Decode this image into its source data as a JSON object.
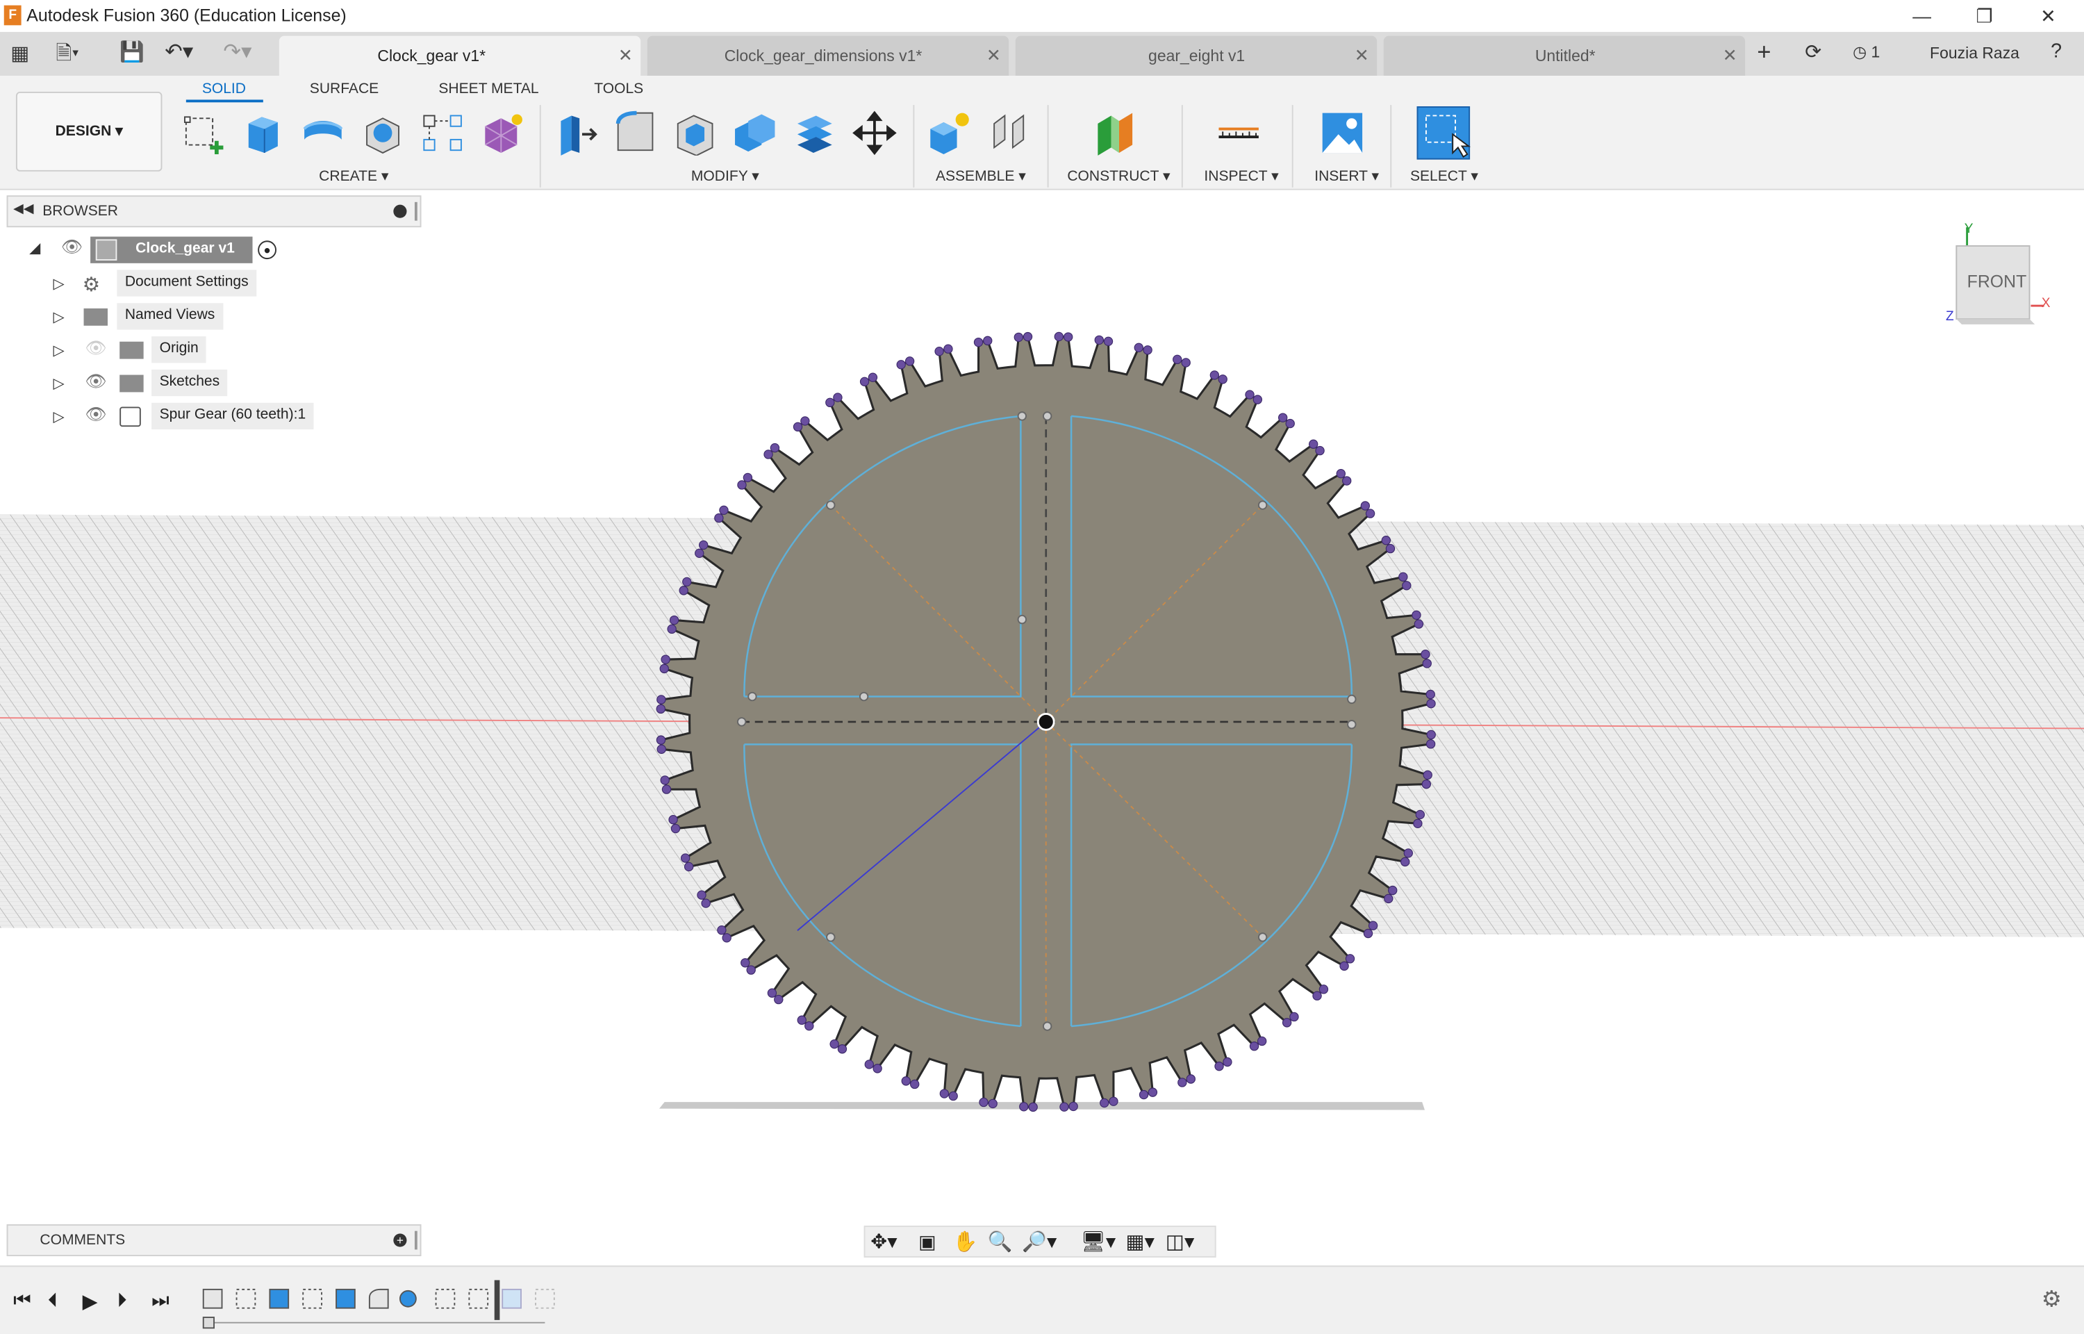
{
  "app": {
    "title": "Autodesk Fusion 360 (Education License)"
  },
  "tabs": [
    {
      "label": "Clock_gear v1*",
      "active": true
    },
    {
      "label": "Clock_gear_dimensions v1*",
      "active": false
    },
    {
      "label": "gear_eight v1",
      "active": false
    },
    {
      "label": "Untitled*",
      "active": false
    }
  ],
  "header": {
    "jobs_count": "1",
    "user": "Fouzia Raza"
  },
  "ribbon": {
    "design_label": "DESIGN",
    "tabs": [
      "SOLID",
      "SURFACE",
      "SHEET METAL",
      "TOOLS"
    ],
    "groups": [
      "CREATE",
      "MODIFY",
      "ASSEMBLE",
      "CONSTRUCT",
      "INSPECT",
      "INSERT",
      "SELECT"
    ]
  },
  "browser": {
    "title": "BROWSER",
    "root": "Clock_gear v1",
    "items": [
      "Document Settings",
      "Named Views",
      "Origin",
      "Sketches",
      "Spur Gear (60 teeth):1"
    ]
  },
  "viewcube": {
    "face": "FRONT",
    "axis_y": "Y",
    "axis_x": "X",
    "axis_z": "Z"
  },
  "comments": {
    "title": "COMMENTS"
  },
  "colors": {
    "accent": "#0b6ec5",
    "gear_fill": "#8a8578",
    "sketch_line": "#5fb0d8",
    "point": "#6a4fa0",
    "ribbon_bg": "#f2f2f2"
  }
}
